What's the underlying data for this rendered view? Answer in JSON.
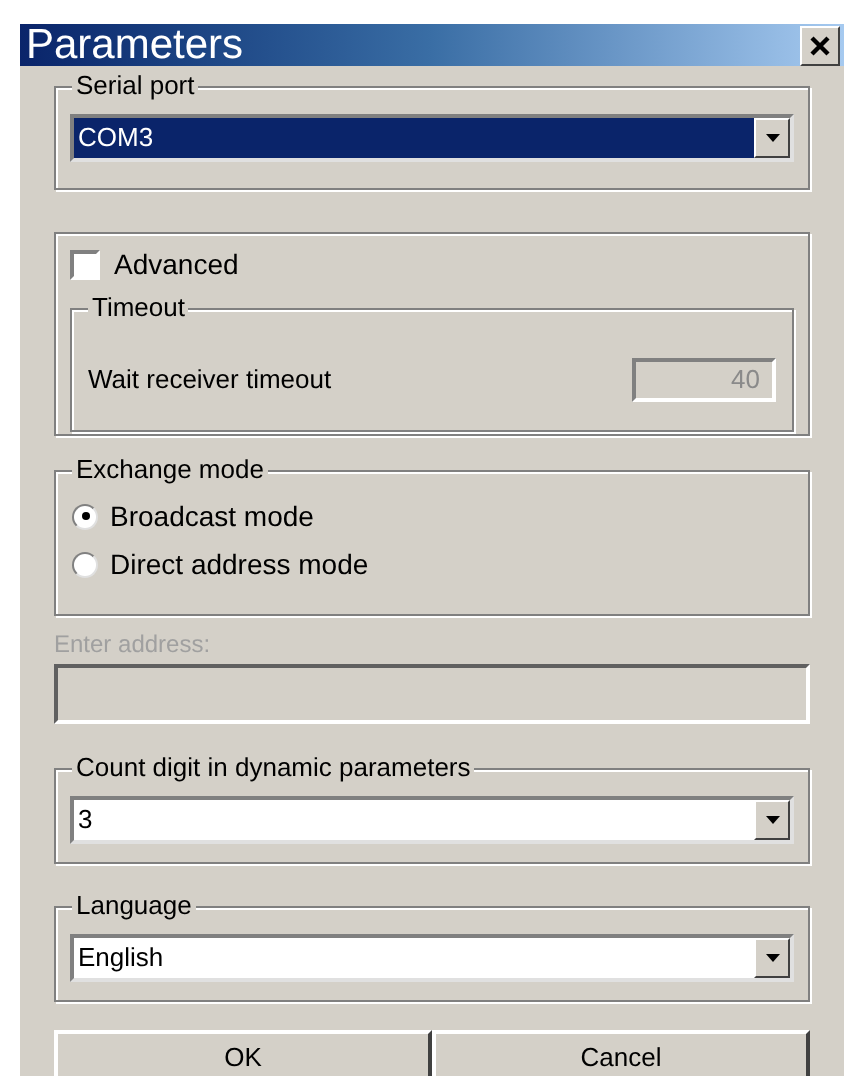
{
  "window": {
    "title": "Parameters"
  },
  "serial_port": {
    "label": "Serial port",
    "value": "COM3",
    "selected": true
  },
  "advanced": {
    "label": "Advanced",
    "checked": false,
    "timeout": {
      "label": "Timeout",
      "field_label": "Wait receiver timeout",
      "value": "40",
      "disabled": true
    }
  },
  "exchange_mode": {
    "label": "Exchange mode",
    "options": [
      {
        "label": "Broadcast mode",
        "selected": true
      },
      {
        "label": "Direct address mode",
        "selected": false
      }
    ]
  },
  "address": {
    "label": "Enter address:",
    "disabled": true
  },
  "count_digit": {
    "label": "Count digit in dynamic parameters",
    "value": "3",
    "selected": false
  },
  "language": {
    "label": "Language",
    "value": "English",
    "selected": false
  },
  "buttons": [
    {
      "label": "OK"
    },
    {
      "label": "Cancel"
    }
  ]
}
